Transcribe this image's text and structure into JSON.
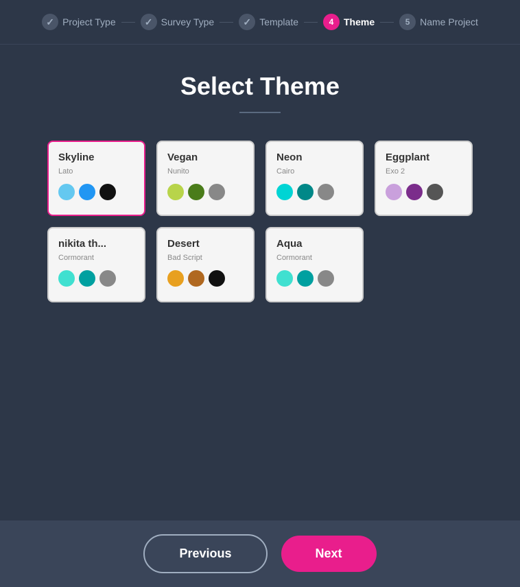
{
  "stepper": {
    "steps": [
      {
        "id": "project-type",
        "label": "Project Type",
        "state": "completed",
        "number": null
      },
      {
        "id": "survey-type",
        "label": "Survey Type",
        "state": "completed",
        "number": null
      },
      {
        "id": "template",
        "label": "Template",
        "state": "completed",
        "number": null
      },
      {
        "id": "theme",
        "label": "Theme",
        "state": "active",
        "number": "4"
      },
      {
        "id": "name-project",
        "label": "Name Project",
        "state": "inactive",
        "number": "5"
      }
    ]
  },
  "page": {
    "title": "Select Theme",
    "divider": true
  },
  "themes": [
    {
      "id": "skyline",
      "name": "Skyline",
      "font": "Lato",
      "selected": true,
      "colors": [
        "#64c8f0",
        "#2196f3",
        "#111111"
      ]
    },
    {
      "id": "vegan",
      "name": "Vegan",
      "font": "Nunito",
      "selected": false,
      "colors": [
        "#b8d44a",
        "#4a7c1a",
        "#888888"
      ]
    },
    {
      "id": "neon",
      "name": "Neon",
      "font": "Cairo",
      "selected": false,
      "colors": [
        "#00d4d4",
        "#008888",
        "#888888"
      ]
    },
    {
      "id": "eggplant",
      "name": "Eggplant",
      "font": "Exo 2",
      "selected": false,
      "colors": [
        "#c9a0dc",
        "#7b2d8b",
        "#555555"
      ]
    },
    {
      "id": "nikita",
      "name": "nikita th...",
      "font": "Cormorant",
      "selected": false,
      "colors": [
        "#40e0d0",
        "#00a0a0",
        "#888888"
      ]
    },
    {
      "id": "desert",
      "name": "Desert",
      "font": "Bad Script",
      "selected": false,
      "colors": [
        "#e8a020",
        "#b06820",
        "#111111"
      ]
    },
    {
      "id": "aqua",
      "name": "Aqua",
      "font": "Cormorant",
      "selected": false,
      "colors": [
        "#40e0d0",
        "#00a0a0",
        "#888888"
      ]
    }
  ],
  "footer": {
    "prev_label": "Previous",
    "next_label": "Next"
  }
}
